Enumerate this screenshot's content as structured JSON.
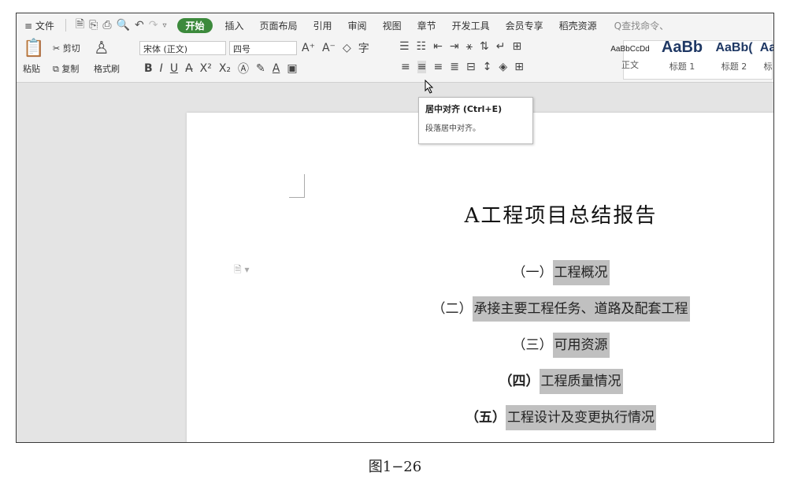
{
  "menubar": {
    "file_label": "≡ 文件",
    "tabs": [
      "开始",
      "插入",
      "页面布局",
      "引用",
      "审阅",
      "视图",
      "章节",
      "开发工具",
      "会员专享",
      "稻壳资源"
    ],
    "search_placeholder": "Q查找命令、"
  },
  "ribbon": {
    "paste_label": "粘贴",
    "cut_label": "剪切",
    "copy_label": "复制",
    "format_painter_label": "格式刷",
    "font_name": "宋体 (正文)",
    "font_size": "四号",
    "styles": [
      {
        "sample": "AaBbCcDd",
        "caption": "正文"
      },
      {
        "sample": "AaBb",
        "caption": "标题 1"
      },
      {
        "sample": "AaBb(",
        "caption": "标题 2"
      },
      {
        "sample": "Aa",
        "caption": "标"
      }
    ]
  },
  "tooltip": {
    "title": "居中对齐 (Ctrl+E)",
    "description": "段落居中对齐。"
  },
  "document": {
    "title": "A工程项目总结报告",
    "lines": [
      {
        "prefix": "（一）",
        "text": "工程概况"
      },
      {
        "prefix": "（二）",
        "text": "承接主要工程任务、道路及配套工程"
      },
      {
        "prefix": "（三）",
        "text": "可用资源"
      },
      {
        "prefix": "（四）",
        "text": "工程质量情况"
      },
      {
        "prefix": "（五）",
        "text": "工程设计及变更执行情况"
      }
    ]
  },
  "caption": "图1−26",
  "colors": {
    "active_tab": "#3c8a3c",
    "highlight": "#c0c0c0"
  }
}
